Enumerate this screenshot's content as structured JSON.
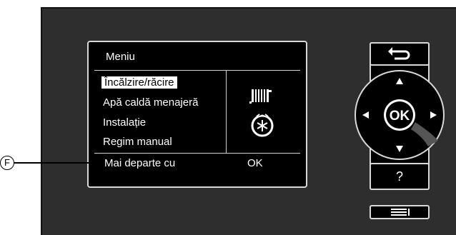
{
  "screen": {
    "title": "Meniu",
    "menu_items": [
      {
        "label": "Încălzire/răcire",
        "selected": true
      },
      {
        "label": "Apă caldă menajeră",
        "selected": false
      },
      {
        "label": "Instalație",
        "selected": false
      },
      {
        "label": "Regim manual",
        "selected": false
      }
    ],
    "footer_left": "Mai departe cu",
    "footer_right": "OK",
    "icons": [
      "radiator-icon",
      "heating-cooling-snowflake-icon"
    ]
  },
  "callout": {
    "label": "F"
  },
  "controls": {
    "back_icon": "back-arrow-icon",
    "ok_label": "OK",
    "up_icon": "arrow-up-icon",
    "down_icon": "arrow-down-icon",
    "left_icon": "arrow-left-icon",
    "right_icon": "arrow-right-icon",
    "help_label": "?",
    "menu_icon": "menu-list-icon"
  },
  "colors": {
    "panel": "#2e2e2e",
    "screen": "#000000",
    "border": "#d8d8d8"
  }
}
